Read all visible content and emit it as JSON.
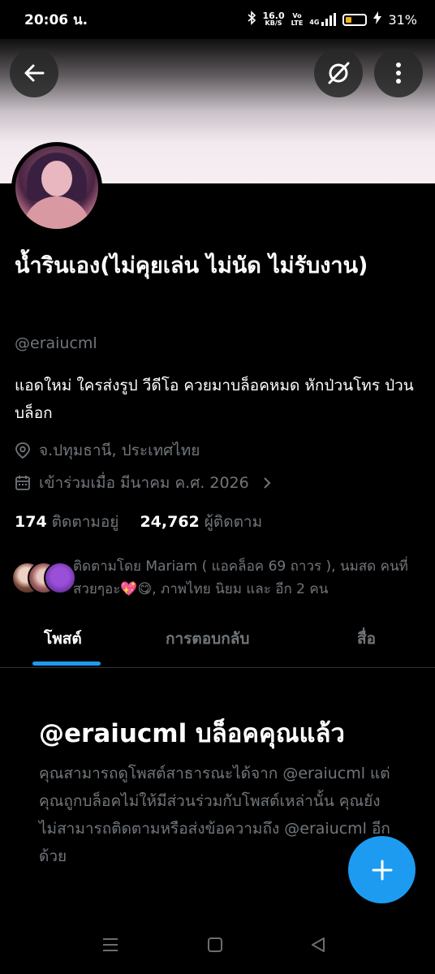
{
  "status_bar": {
    "time": "20:06 น.",
    "speed_value": "16.0",
    "speed_unit": "KB/S",
    "volte_top": "Vo",
    "volte_bottom": "LTE",
    "network": "4G",
    "battery_percent": 31,
    "battery_label": "31%",
    "battery_color": "#f2b21a"
  },
  "profile": {
    "display_name": "น้ำรินเอง(ไม่คุยเล่น ไม่นัด ไม่รับงาน)",
    "handle": "@eraiucml",
    "bio": "แอดใหม่ ใครส่งรูป วีดีโอ ควยมาบล็อคหมด หักป่วนโทร ป่วนบล็อก",
    "location": "จ.ปทุมธานี, ประเทศไทย",
    "joined": "เข้าร่วมเมื่อ มีนาคม ค.ศ. 2026",
    "following_count": "174",
    "following_label": "ติดตามอยู่",
    "followers_count": "24,762",
    "followers_label": "ผู้ติดตาม",
    "followed_by": "ติดตามโดย Mariam ( แอคล็อค 69 ถาวร ), นมสด คนที่สวยๆอะ💖😋, ภาพไทย นิยม และ อีก 2 คน"
  },
  "tabs": [
    {
      "label": "โพสต์"
    },
    {
      "label": "การตอบกลับ"
    },
    {
      "label": "สื่อ"
    }
  ],
  "blocked": {
    "title": "@eraiucml บล็อคคุณแล้ว",
    "body": "คุณสามารถดูโพสต์สาธารณะได้จาก @eraiucml แต่คุณถูกบล็อคไม่ให้มีส่วนร่วมกับโพสต์เหล่านั้น คุณยังไม่สามารถติดตามหรือส่งข้อความถึง @eraiucml อีกด้วย"
  },
  "icons": {
    "back": "back-arrow-icon",
    "grok": "grok-icon",
    "more": "more-vertical-icon",
    "location": "location-pin-icon",
    "calendar": "calendar-icon",
    "fab": "plus-icon"
  },
  "colors": {
    "accent": "#1d9bf0",
    "secondary_text": "#71767b"
  }
}
